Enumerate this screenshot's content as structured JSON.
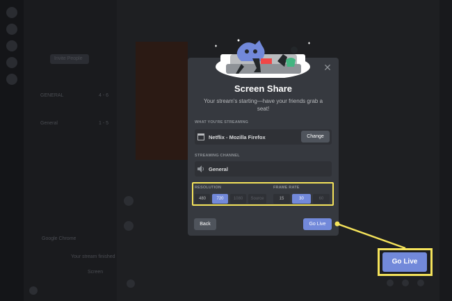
{
  "background": {
    "invite_button": "Invite People",
    "channel_list": [
      "GENERAL",
      "General"
    ],
    "channel_counts": [
      "4 - 6",
      "1 - 5"
    ],
    "voice_channel": "Google Chrome",
    "voice_note": "Your stream finished",
    "stream_label": "Screen"
  },
  "modal": {
    "title": "Screen Share",
    "subtitle": "Your stream's starting—have your friends grab a seat!",
    "streaming_section_label": "WHAT YOU'RE STREAMING",
    "streaming_source": "Netflix - Mozilla Firefox",
    "change_button": "Change",
    "channel_section_label": "STREAMING CHANNEL",
    "channel_name": "General",
    "resolution_label": "RESOLUTION",
    "resolution_options": [
      "480",
      "720",
      "1080",
      "Source"
    ],
    "resolution_selected": "720",
    "frame_rate_label": "FRAME RATE",
    "frame_rate_options": [
      "15",
      "30",
      "60"
    ],
    "frame_rate_selected": "30",
    "back_button": "Back",
    "go_live_button": "Go Live",
    "close_icon": "close-icon"
  },
  "callout": {
    "go_live_button": "Go Live"
  },
  "colors": {
    "accent": "#7289da",
    "highlight": "#f5e35b",
    "modal_bg": "#36393f",
    "field_bg": "#2f3136"
  }
}
